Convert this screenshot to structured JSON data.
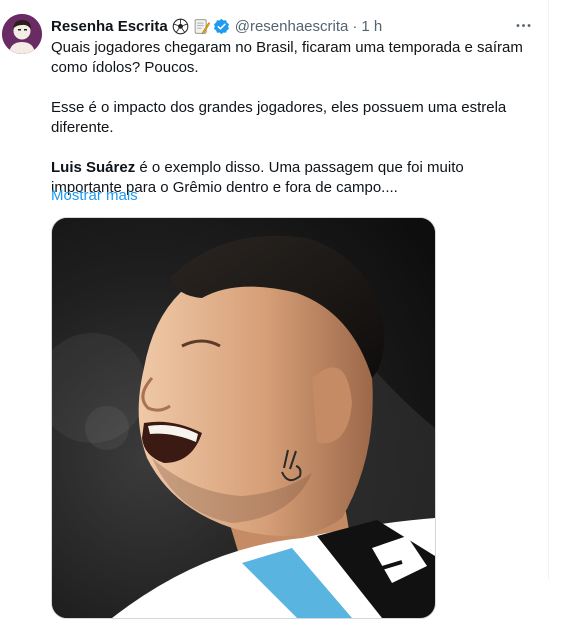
{
  "tweet": {
    "author_name": "Resenha Escrita",
    "handle": "@resenhaescrita",
    "separator": "·",
    "time": "1 h",
    "paragraphs": [
      "Quais jogadores chegaram no Brasil, ficaram uma temporada e saíram como ídolos? Poucos.",
      "Esse é o impacto dos grandes jogadores, eles possuem uma estrela diferente."
    ],
    "highlight_name": "Luis Suárez",
    "highlight_rest": " é o exemplo disso. Uma passagem que foi muito importante para o Grêmio dentro e fora de campo....",
    "show_more": "Mostrar mais"
  },
  "icons": {
    "emoji_1": "soccer-ball-icon",
    "emoji_2": "memo-icon",
    "badge": "verified-badge-icon",
    "more": "more-options-icon"
  },
  "colors": {
    "link": "#1d9bf0",
    "secondary_text": "#536471",
    "verified": "#1d9bf0",
    "avatar_bg": "#6a2a64"
  }
}
